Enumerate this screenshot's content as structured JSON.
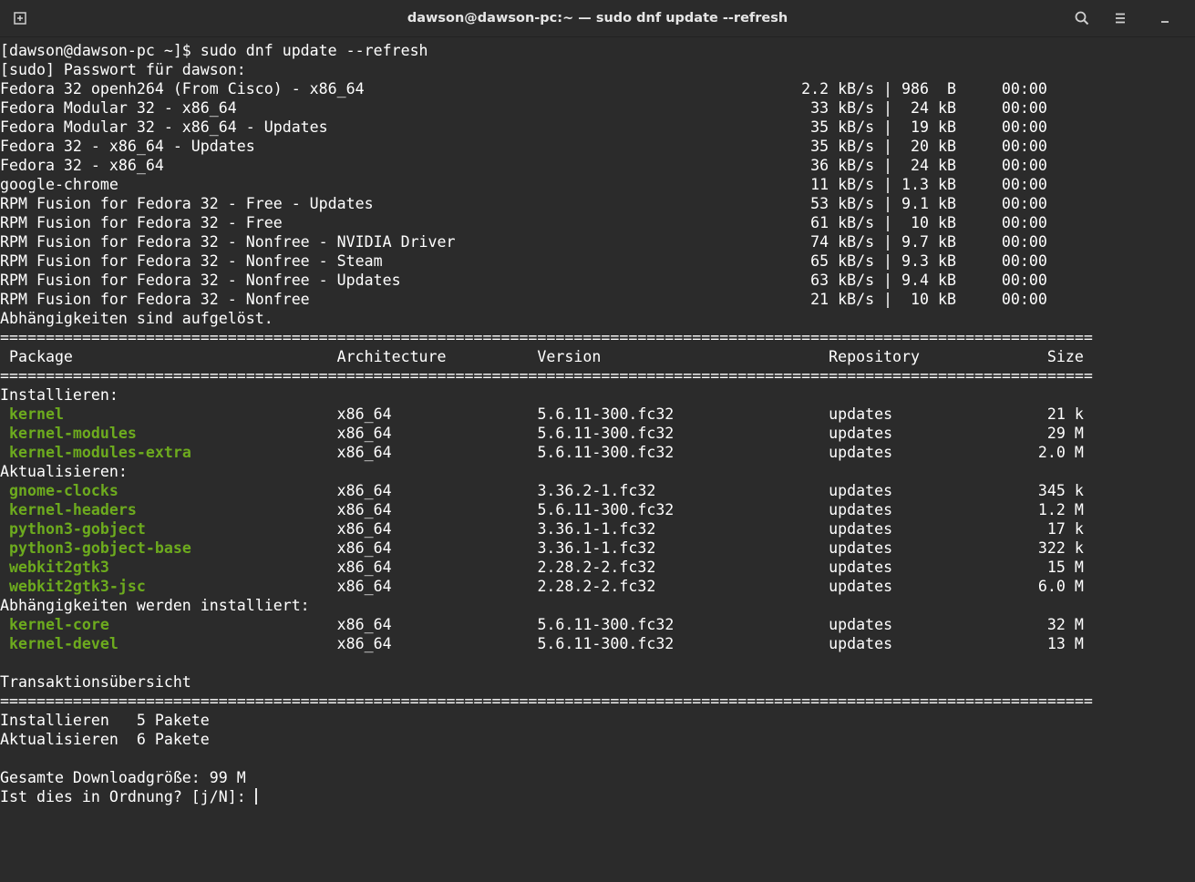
{
  "window": {
    "title": "dawson@dawson-pc:~ — sudo dnf update --refresh",
    "icons": [
      "new-tab-icon",
      "search-icon",
      "menu-icon",
      "minimize-icon"
    ]
  },
  "terminal": {
    "prompt": "[dawson@dawson-pc ~]$ sudo dnf update --refresh",
    "sudo_prompt": "[sudo] Passwort für dawson:",
    "repos": [
      {
        "name": "Fedora 32 openh264 (From Cisco) - x86_64",
        "rate": "2.2 kB/s",
        "size": "986  B",
        "time": "00:00"
      },
      {
        "name": "Fedora Modular 32 - x86_64",
        "rate": "33 kB/s",
        "size": " 24 kB",
        "time": "00:00"
      },
      {
        "name": "Fedora Modular 32 - x86_64 - Updates",
        "rate": "35 kB/s",
        "size": " 19 kB",
        "time": "00:00"
      },
      {
        "name": "Fedora 32 - x86_64 - Updates",
        "rate": "35 kB/s",
        "size": " 20 kB",
        "time": "00:00"
      },
      {
        "name": "Fedora 32 - x86_64",
        "rate": "36 kB/s",
        "size": " 24 kB",
        "time": "00:00"
      },
      {
        "name": "google-chrome",
        "rate": "11 kB/s",
        "size": "1.3 kB",
        "time": "00:00"
      },
      {
        "name": "RPM Fusion for Fedora 32 - Free - Updates",
        "rate": "53 kB/s",
        "size": "9.1 kB",
        "time": "00:00"
      },
      {
        "name": "RPM Fusion for Fedora 32 - Free",
        "rate": "61 kB/s",
        "size": " 10 kB",
        "time": "00:00"
      },
      {
        "name": "RPM Fusion for Fedora 32 - Nonfree - NVIDIA Driver",
        "rate": "74 kB/s",
        "size": "9.7 kB",
        "time": "00:00"
      },
      {
        "name": "RPM Fusion for Fedora 32 - Nonfree - Steam",
        "rate": "65 kB/s",
        "size": "9.3 kB",
        "time": "00:00"
      },
      {
        "name": "RPM Fusion for Fedora 32 - Nonfree - Updates",
        "rate": "63 kB/s",
        "size": "9.4 kB",
        "time": "00:00"
      },
      {
        "name": "RPM Fusion for Fedora 32 - Nonfree",
        "rate": "21 kB/s",
        "size": " 10 kB",
        "time": "00:00"
      }
    ],
    "deps_resolved": "Abhängigkeiten sind aufgelöst.",
    "table_headers": {
      "package": "Package",
      "arch": "Architecture",
      "version": "Version",
      "repo": "Repository",
      "size": "Size"
    },
    "groups": [
      {
        "label": "Installieren:",
        "rows": [
          {
            "package": "kernel",
            "arch": "x86_64",
            "version": "5.6.11-300.fc32",
            "repo": "updates",
            "size": "21 k"
          },
          {
            "package": "kernel-modules",
            "arch": "x86_64",
            "version": "5.6.11-300.fc32",
            "repo": "updates",
            "size": "29 M"
          },
          {
            "package": "kernel-modules-extra",
            "arch": "x86_64",
            "version": "5.6.11-300.fc32",
            "repo": "updates",
            "size": "2.0 M"
          }
        ]
      },
      {
        "label": "Aktualisieren:",
        "rows": [
          {
            "package": "gnome-clocks",
            "arch": "x86_64",
            "version": "3.36.2-1.fc32",
            "repo": "updates",
            "size": "345 k"
          },
          {
            "package": "kernel-headers",
            "arch": "x86_64",
            "version": "5.6.11-300.fc32",
            "repo": "updates",
            "size": "1.2 M"
          },
          {
            "package": "python3-gobject",
            "arch": "x86_64",
            "version": "3.36.1-1.fc32",
            "repo": "updates",
            "size": "17 k"
          },
          {
            "package": "python3-gobject-base",
            "arch": "x86_64",
            "version": "3.36.1-1.fc32",
            "repo": "updates",
            "size": "322 k"
          },
          {
            "package": "webkit2gtk3",
            "arch": "x86_64",
            "version": "2.28.2-2.fc32",
            "repo": "updates",
            "size": "15 M"
          },
          {
            "package": "webkit2gtk3-jsc",
            "arch": "x86_64",
            "version": "2.28.2-2.fc32",
            "repo": "updates",
            "size": "6.0 M"
          }
        ]
      },
      {
        "label": "Abhängigkeiten werden installiert:",
        "rows": [
          {
            "package": "kernel-core",
            "arch": "x86_64",
            "version": "5.6.11-300.fc32",
            "repo": "updates",
            "size": "32 M"
          },
          {
            "package": "kernel-devel",
            "arch": "x86_64",
            "version": "5.6.11-300.fc32",
            "repo": "updates",
            "size": "13 M"
          }
        ]
      }
    ],
    "summary_title": "Transaktionsübersicht",
    "summary": [
      {
        "action": "Installieren",
        "count": "5 Pakete"
      },
      {
        "action": "Aktualisieren",
        "count": "6 Pakete"
      }
    ],
    "download_size": "Gesamte Downloadgröße: 99 M",
    "confirm_prompt": "Ist dies in Ordnung? [j/N]: "
  },
  "colors": {
    "background": "#2b2b2b",
    "text": "#ffffff",
    "package": "#6dab1e"
  }
}
